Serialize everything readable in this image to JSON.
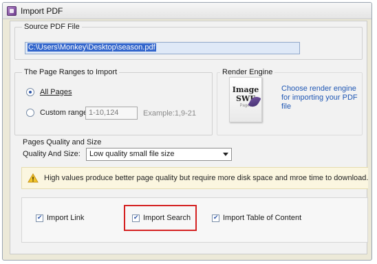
{
  "window": {
    "title": "Import PDF",
    "icon": "pdf-app-icon"
  },
  "source": {
    "group_title": "Source PDF File",
    "path_value": "C:\\Users\\Monkey\\Desktop\\season.pdf"
  },
  "page_ranges": {
    "group_title": "The Page Ranges to Import",
    "all_pages_label": "All Pages",
    "all_pages_checked": true,
    "custom_range_label": "Custom range:",
    "custom_range_checked": false,
    "custom_range_value": "1-10,124",
    "example_text": "Example:1,9-21"
  },
  "render_engine": {
    "group_title": "Render Engine",
    "card_line1": "Image",
    "card_line2": "SWF",
    "card_line3": "Pages",
    "description": "Choose render engine for importing your PDF file"
  },
  "quality": {
    "group_title": "Pages Quality and Size",
    "label": "Quality And Size:",
    "selected": "Low quality small file size"
  },
  "warning": {
    "icon": "warning-icon",
    "text": "High values produce better page quality but require more disk space and mroe time to download."
  },
  "options": {
    "import_link_label": "Import Link",
    "import_link_checked": true,
    "import_search_label": "Import Search",
    "import_search_checked": true,
    "import_toc_label": "Import Table of Content",
    "import_toc_checked": true
  },
  "colors": {
    "highlight": "#d42020",
    "link_text": "#1f57b4",
    "selection": "#3366cc"
  }
}
